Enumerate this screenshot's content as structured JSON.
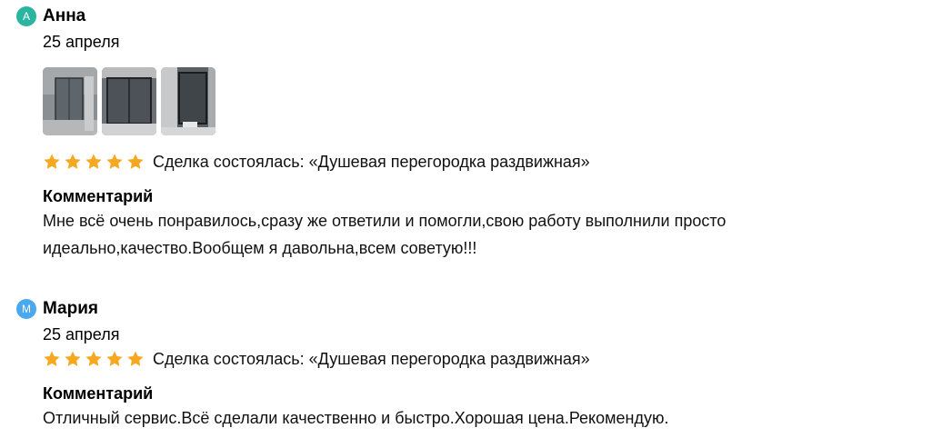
{
  "reviews": [
    {
      "avatar_letter": "А",
      "avatar_color": "#2bb5a0",
      "author": "Анна",
      "date": "25 апреля",
      "photos": [
        {
          "alt": "photo-1"
        },
        {
          "alt": "photo-2"
        },
        {
          "alt": "photo-3"
        }
      ],
      "rating": 5,
      "deal": "Сделка состоялась: «Душевая перегородка раздвижная»",
      "comment_title": "Комментарий",
      "comment": "Мне всё очень понравилось,сразу же ответили и помогли,свою работу выполнили просто идеально,качество.Вообщем я давольна,всем советую!!!"
    },
    {
      "avatar_letter": "М",
      "avatar_color": "#4aa8f0",
      "author": "Мария",
      "date": "25 апреля",
      "rating": 5,
      "deal": "Сделка состоялась: «Душевая перегородка раздвижная»",
      "comment_title": "Комментарий",
      "comment": "Отличный сервис.Всё сделали качественно и быстро.Хорошая цена.Рекомендую."
    }
  ],
  "colors": {
    "star": "#f7a821"
  }
}
